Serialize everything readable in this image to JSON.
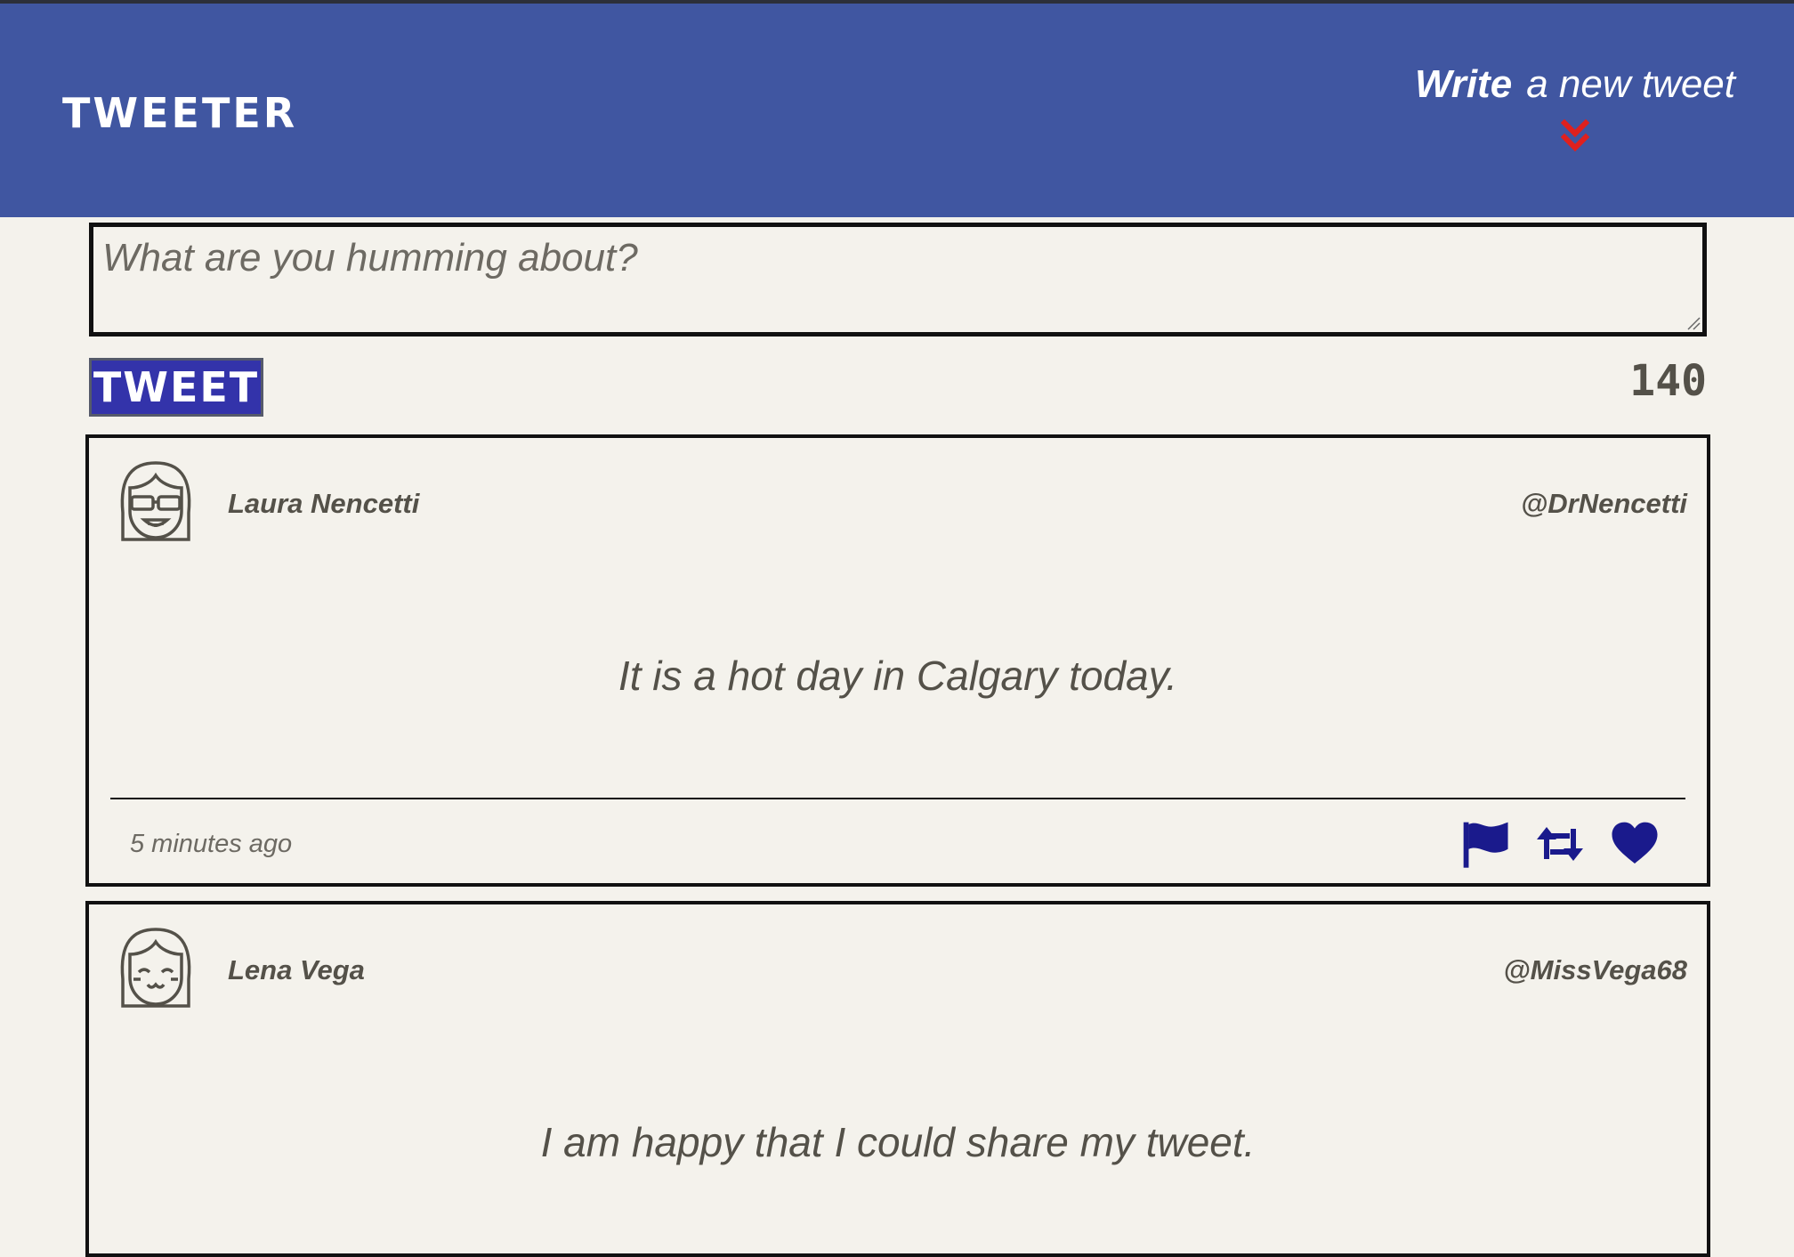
{
  "header": {
    "brand": "TWEETER",
    "compose_toggle": {
      "bold": "Write",
      "rest": "a new tweet",
      "icon": "double-chevron-down-icon"
    }
  },
  "compose": {
    "placeholder": "What are you humming about?",
    "value": "",
    "submit_label": "TWEET",
    "counter": "140"
  },
  "tweets": [
    {
      "avatar": "avatar-glasses-girl-icon",
      "name": "Laura Nencetti",
      "handle": "@DrNencetti",
      "text": "It is a hot day in Calgary today.",
      "timestamp": "5 minutes ago",
      "actions": [
        "flag-icon",
        "retweet-icon",
        "heart-icon"
      ]
    },
    {
      "avatar": "avatar-smiling-girl-icon",
      "name": "Lena Vega",
      "handle": "@MissVega68",
      "text": "I am happy that I could share my tweet."
    }
  ],
  "colors": {
    "navbar": "#4056a1",
    "background": "#f4f2ec",
    "text": "#545149",
    "button": "#3333aa",
    "action_icons": "#1a1a8c",
    "chevron": "#e0201e"
  }
}
